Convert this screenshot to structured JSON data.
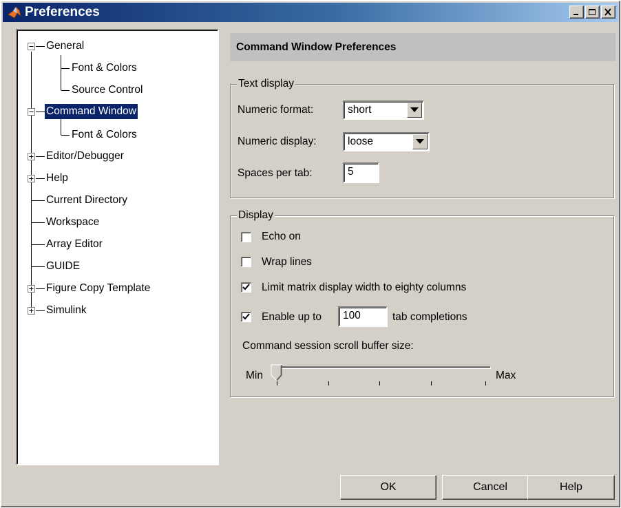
{
  "window": {
    "title": "Preferences"
  },
  "tree": {
    "items": [
      {
        "label": "General",
        "expander": "minus"
      },
      {
        "label": "Font & Colors"
      },
      {
        "label": "Source Control"
      },
      {
        "label": "Command Window",
        "expander": "minus",
        "selected": true
      },
      {
        "label": "Font & Colors"
      },
      {
        "label": "Editor/Debugger",
        "expander": "plus"
      },
      {
        "label": "Help",
        "expander": "plus"
      },
      {
        "label": "Current Directory"
      },
      {
        "label": "Workspace"
      },
      {
        "label": "Array Editor"
      },
      {
        "label": "GUIDE"
      },
      {
        "label": "Figure Copy Template",
        "expander": "plus"
      },
      {
        "label": "Simulink",
        "expander": "plus"
      }
    ]
  },
  "panel": {
    "header": "Command Window Preferences",
    "text_display": {
      "title": "Text display",
      "numeric_format_label": "Numeric format:",
      "numeric_format_value": "short",
      "numeric_display_label": "Numeric display:",
      "numeric_display_value": "loose",
      "spaces_per_tab_label": "Spaces per tab:",
      "spaces_per_tab_value": "5"
    },
    "display": {
      "title": "Display",
      "echo_on_label": "Echo on",
      "echo_on_checked": false,
      "wrap_lines_label": "Wrap lines",
      "wrap_lines_checked": false,
      "limit_width_label": "Limit matrix display width to eighty columns",
      "limit_width_checked": true,
      "enable_up_to_label": "Enable up to",
      "enable_up_to_checked": true,
      "tab_completions_value": "100",
      "tab_completions_label": "tab completions",
      "scroll_buffer_label": "Command session scroll buffer size:",
      "slider_min_label": "Min",
      "slider_max_label": "Max",
      "slider_level": 0
    }
  },
  "buttons": {
    "ok": "OK",
    "cancel": "Cancel",
    "help": "Help"
  },
  "colors": {
    "title_bar": "#0a246a",
    "selection": "#0a246a",
    "face": "#d4d0c8"
  }
}
